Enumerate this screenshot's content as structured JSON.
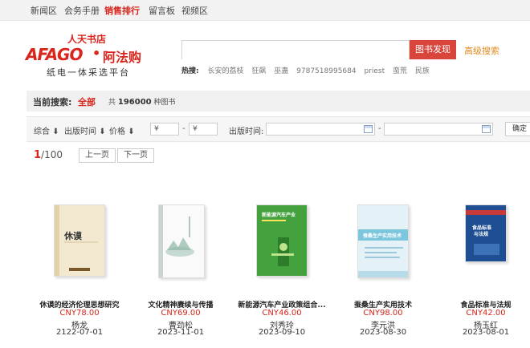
{
  "nav": [
    "新闻区",
    "会务手册",
    "销售排行",
    "留言板",
    "视频区"
  ],
  "nav_active": 2,
  "logo": {
    "top_text": "人天书店",
    "mark": "AFAGO",
    "dot": "•",
    "cn": "阿法购",
    "slogan": "纸电一体采选平台"
  },
  "search": {
    "value": "",
    "button": "图书发现",
    "advanced": "高级搜索",
    "hot_label": "热搜:",
    "hot_words": [
      "长安的荔枝",
      "狂飙",
      "巫蛊",
      "9787518995684",
      "priest",
      "蛮荒",
      "民族"
    ]
  },
  "current_search": {
    "label": "当前搜索:",
    "value": "全部",
    "count_prefix": "共",
    "count": "196000",
    "count_suffix": "种图书"
  },
  "filters": {
    "sort_default": "综合",
    "sort_pubtime": "出版时间",
    "sort_price": "价格",
    "price_from_placeholder": "¥",
    "price_to_placeholder": "¥",
    "dash": "-",
    "time_label": "出版时间:",
    "confirm": "确定"
  },
  "pager": {
    "current": "1",
    "total": "/100",
    "prev": "上一页",
    "next": "下一页"
  },
  "books": [
    {
      "title": "休谟的经济伦理思想研究",
      "price": "CNY78.00",
      "author": "杨龙",
      "date": "2122-07-01",
      "cover_text": "休谟的经济伦理思想研究"
    },
    {
      "title": "文化精神赓续与传播",
      "price": "CNY69.00",
      "author": "曹劲松",
      "date": "2023-11-01",
      "cover_text": ""
    },
    {
      "title": "新能源汽车产业政策组合...",
      "price": "CNY46.00",
      "author": "刘秀玲",
      "date": "2023-09-10",
      "cover_text": "新能源汽车产业"
    },
    {
      "title": "蚕桑生产实用技术",
      "price": "CNY98.00",
      "author": "李元洪",
      "date": "2023-08-30",
      "cover_text": "蚕桑生产实用技术"
    },
    {
      "title": "食品标准与法规",
      "price": "CNY42.00",
      "author": "杨玉红",
      "date": "2023-08-01",
      "cover_text": "食品标准与法规"
    }
  ]
}
